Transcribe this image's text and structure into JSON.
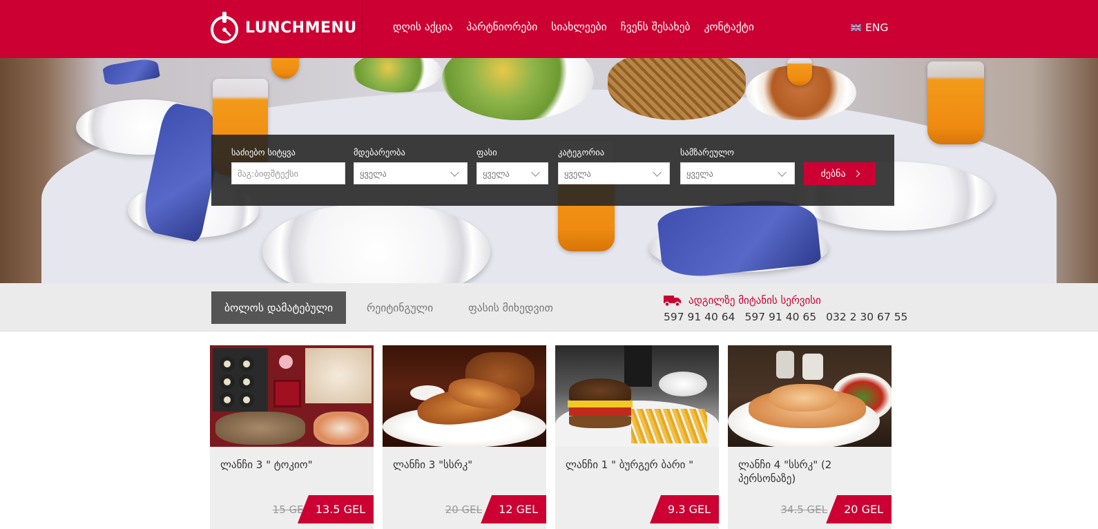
{
  "header": {
    "logo_text": "LUNCHMENU",
    "nav": [
      "დღის აქცია",
      "პარტნიორები",
      "სიახლეები",
      "ჩვენს შესახებ",
      "კონტაქტი"
    ],
    "language": "ENG"
  },
  "search": {
    "keyword_label": "საძიებო სიტყვა",
    "keyword_placeholder": "მაგ:ბიფშტექსი",
    "location_label": "მდებარეობა",
    "location_value": "ყველა",
    "price_label": "ფასი",
    "price_value": "ყველა",
    "category_label": "კატეგორია",
    "category_value": "ყველა",
    "cuisine_label": "სამზარეულო",
    "cuisine_value": "ყველა",
    "button_label": "ძებნა"
  },
  "tabs": [
    "ბოლოს დამატებული",
    "რეიტინგული",
    "ფასის მიხედვით"
  ],
  "delivery": {
    "title": "ადგილზე მიტანის სერვისი",
    "phones": [
      "597 91 40 64",
      "597 91 40 65",
      "032 2 30 67 55"
    ]
  },
  "cards": [
    {
      "title": "ლანჩი 3 \" ტოკიო\"",
      "old_price": "15 GEL",
      "price": "13.5 GEL"
    },
    {
      "title": "ლანჩი 3 \"სსრკ\"",
      "old_price": "20 GEL",
      "price": "12 GEL"
    },
    {
      "title": "ლანჩი 1 \" ბურგერ ბარი \"",
      "old_price": "",
      "price": "9.3 GEL"
    },
    {
      "title": "ლანჩი 4 \"სსრკ\" (2 პერსონაზე)",
      "old_price": "34.5 GEL",
      "price": "20 GEL"
    }
  ],
  "colors": {
    "brand_red": "#cc0033",
    "panel_dark": "#232323",
    "tab_active": "#555555"
  },
  "icons": [
    "logo-plate-icon",
    "uk-flag-icon",
    "chevron-down-icon",
    "chevron-right-icon",
    "delivery-truck-icon"
  ]
}
